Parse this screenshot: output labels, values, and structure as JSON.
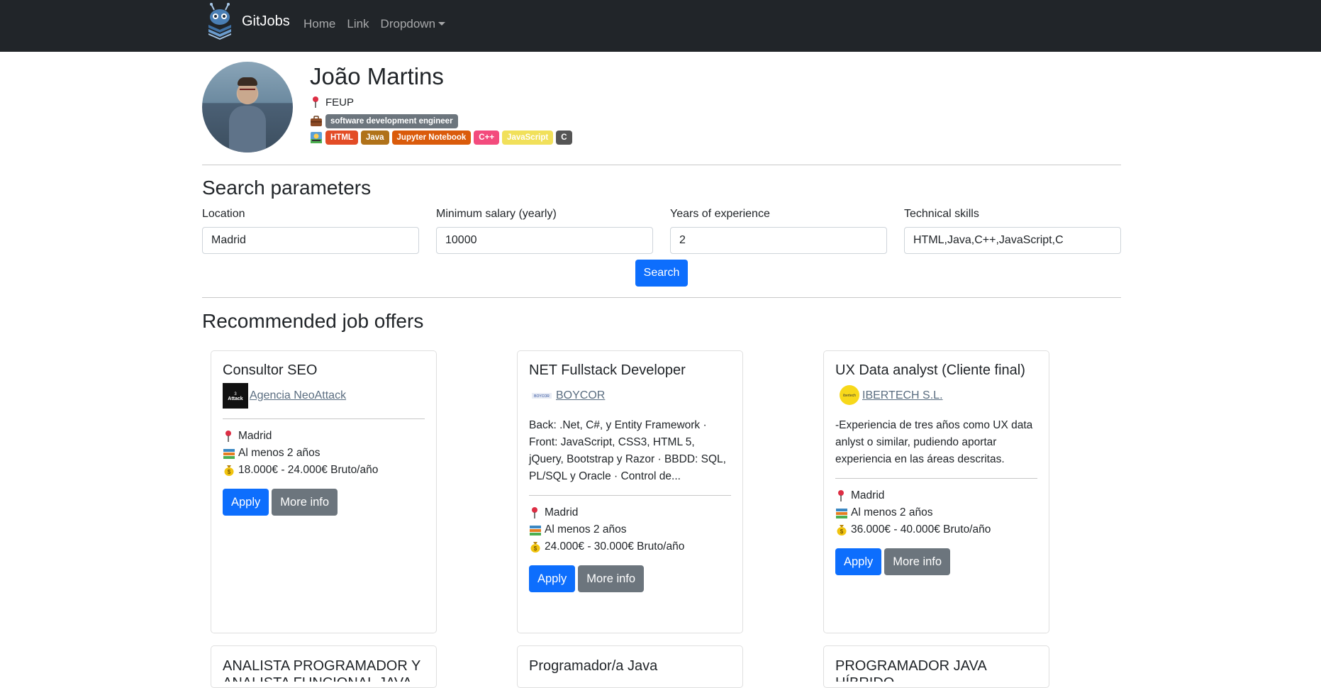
{
  "navbar": {
    "brand": "GitJobs",
    "links": [
      "Home",
      "Link",
      "Dropdown"
    ]
  },
  "profile": {
    "name": "João Martins",
    "location": "FEUP",
    "job_title": "software development engineer",
    "skills": [
      {
        "label": "HTML",
        "color": "#e34c26"
      },
      {
        "label": "Java",
        "color": "#b07219"
      },
      {
        "label": "Jupyter Notebook",
        "color": "#da5b0b"
      },
      {
        "label": "C++",
        "color": "#f34b7d"
      },
      {
        "label": "JavaScript",
        "color": "#f1e05a"
      },
      {
        "label": "C",
        "color": "#555555"
      }
    ]
  },
  "search": {
    "title": "Search parameters",
    "fields": [
      {
        "label": "Location",
        "value": "Madrid"
      },
      {
        "label": "Minimum salary (yearly)",
        "value": "10000"
      },
      {
        "label": "Years of experience",
        "value": "2"
      },
      {
        "label": "Technical skills",
        "value": "HTML,Java,C++,JavaScript,C"
      }
    ],
    "button": "Search"
  },
  "recommended": {
    "title": "Recommended job offers",
    "apply_label": "Apply",
    "more_label": "More info",
    "offers": [
      {
        "title": "Consultor SEO",
        "company": "Agencia NeoAttack",
        "description": "",
        "location": "Madrid",
        "experience": "Al menos 2 años",
        "salary": "18.000€ - 24.000€ Bruto/año"
      },
      {
        "title": "NET Fullstack Developer",
        "company": "BOYCOR",
        "description": "Back: .Net, C#, y Entity Framework · Front: JavaScript, CSS3, HTML 5, jQuery, Bootstrap y Razor · BBDD: SQL, PL/SQL y Oracle · Control de...",
        "location": "Madrid",
        "experience": "Al menos 2 años",
        "salary": "24.000€ - 30.000€ Bruto/año"
      },
      {
        "title": "UX Data analyst (Cliente final)",
        "company": "IBERTECH S.L.",
        "description": "-Experiencia de tres años como UX data anlyst o similar, pudiendo aportar experiencia en las áreas descritas.",
        "location": "Madrid",
        "experience": "Al menos 2 años",
        "salary": "36.000€ - 40.000€ Bruto/año"
      },
      {
        "title": "ANALISTA PROGRAMADOR Y ANALISTA FUNCIONAL JAVA"
      },
      {
        "title": "Programador/a Java"
      },
      {
        "title": "PROGRAMADOR JAVA HÍBRIDO"
      }
    ]
  },
  "colors": {
    "navbar": "#212529",
    "primary": "#0d6efd",
    "secondary": "#6c757d",
    "badge_gray": "#6c757d"
  },
  "icons": {
    "location": "pushpin-icon",
    "job": "briefcase-icon",
    "skills": "construction-icon",
    "experience": "books-icon",
    "salary": "money-bag-icon"
  }
}
